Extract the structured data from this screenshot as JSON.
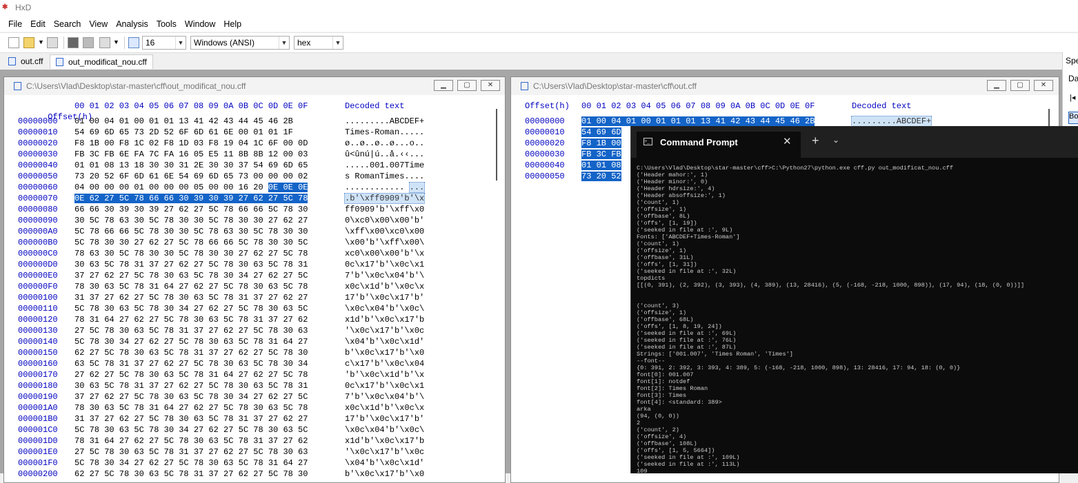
{
  "app": {
    "title": "HxD"
  },
  "menu": [
    "File",
    "Edit",
    "Search",
    "View",
    "Analysis",
    "Tools",
    "Window",
    "Help"
  ],
  "toolbar": {
    "bytes_per_row": "16",
    "charset": "Windows (ANSI)",
    "display": "hex"
  },
  "tabs": [
    {
      "label": "out.cff"
    },
    {
      "label": "out_modificat_nou.cff"
    }
  ],
  "right_panel": {
    "label_top": "Spe",
    "label_da": "Da",
    "label_bo": "Bo"
  },
  "left_window": {
    "path": "C:\\Users\\Vlad\\Desktop\\star-master\\cff\\out_modificat_nou.cff",
    "header_offset": "Offset(h)",
    "header_cols": "00 01 02 03 04 05 06 07 08 09 0A 0B 0C 0D 0E 0F",
    "header_text": "Decoded text",
    "rows": [
      {
        "o": "00000000",
        "h": "01 00 04 01 00 01 01 13 41 42 43 44 45 46 2B",
        "a": ".........ABCDEF+"
      },
      {
        "o": "00000010",
        "h": "54 69 6D 65 73 2D 52 6F 6D 61 6E 00 01 01 1F",
        "a": "Times-Roman....."
      },
      {
        "o": "00000020",
        "h": "F8 1B 00 F8 1C 02 F8 1D 03 F8 19 04 1C 6F 00 0D",
        "a": "ø..ø..ø..ø...o.."
      },
      {
        "o": "00000030",
        "h": "FB 3C FB 6E FA 7C FA 16 05 E5 11 8B 8B 12 00 03",
        "a": "û<ûnú|ú..å.‹‹..."
      },
      {
        "o": "00000040",
        "h": "01 01 08 13 18 30 30 31 2E 30 30 37 54 69 6D 65",
        "a": ".....001.007Time"
      },
      {
        "o": "00000050",
        "h": "73 20 52 6F 6D 61 6E 54 69 6D 65 73 00 00 00 02",
        "a": "s RomanTimes...."
      },
      {
        "o": "00000060",
        "h": "04 00 00 00 01 00 00 00 05 00 00 16 20 ",
        "hs": "0E 0E 0E",
        "a": "............ ",
        "as": "..."
      },
      {
        "o": "00000070",
        "hs": "0E 62 27 5C 78 66 66 30 39 30 39 27 62 27 5C 78",
        "as": ".b'\\xff0909'b'\\x"
      },
      {
        "o": "00000080",
        "h": "66 66 30 39 30 39 27 62 27 5C 78 66 66 5C 78 30",
        "a": "ff0909'b'\\xff\\x0"
      },
      {
        "o": "00000090",
        "h": "30 5C 78 63 30 5C 78 30 30 5C 78 30 30 27 62 27",
        "a": "0\\xc0\\x00\\x00'b'"
      },
      {
        "o": "000000A0",
        "h": "5C 78 66 66 5C 78 30 30 5C 78 63 30 5C 78 30 30",
        "a": "\\xff\\x00\\xc0\\x00"
      },
      {
        "o": "000000B0",
        "h": "5C 78 30 30 27 62 27 5C 78 66 66 5C 78 30 30 5C",
        "a": "\\x00'b'\\xff\\x00\\"
      },
      {
        "o": "000000C0",
        "h": "78 63 30 5C 78 30 30 5C 78 30 30 27 62 27 5C 78",
        "a": "xc0\\x00\\x00'b'\\x"
      },
      {
        "o": "000000D0",
        "h": "30 63 5C 78 31 37 27 62 27 5C 78 30 63 5C 78 31",
        "a": "0c\\x17'b'\\x0c\\x1"
      },
      {
        "o": "000000E0",
        "h": "37 27 62 27 5C 78 30 63 5C 78 30 34 27 62 27 5C",
        "a": "7'b'\\x0c\\x04'b'\\"
      },
      {
        "o": "000000F0",
        "h": "78 30 63 5C 78 31 64 27 62 27 5C 78 30 63 5C 78",
        "a": "x0c\\x1d'b'\\x0c\\x"
      },
      {
        "o": "00000100",
        "h": "31 37 27 62 27 5C 78 30 63 5C 78 31 37 27 62 27",
        "a": "17'b'\\x0c\\x17'b'"
      },
      {
        "o": "00000110",
        "h": "5C 78 30 63 5C 78 30 34 27 62 27 5C 78 30 63 5C",
        "a": "\\x0c\\x04'b'\\x0c\\"
      },
      {
        "o": "00000120",
        "h": "78 31 64 27 62 27 5C 78 30 63 5C 78 31 37 27 62",
        "a": "x1d'b'\\x0c\\x17'b"
      },
      {
        "o": "00000130",
        "h": "27 5C 78 30 63 5C 78 31 37 27 62 27 5C 78 30 63",
        "a": "'\\x0c\\x17'b'\\x0c"
      },
      {
        "o": "00000140",
        "h": "5C 78 30 34 27 62 27 5C 78 30 63 5C 78 31 64 27",
        "a": "\\x04'b'\\x0c\\x1d'"
      },
      {
        "o": "00000150",
        "h": "62 27 5C 78 30 63 5C 78 31 37 27 62 27 5C 78 30",
        "a": "b'\\x0c\\x17'b'\\x0"
      },
      {
        "o": "00000160",
        "h": "63 5C 78 31 37 27 62 27 5C 78 30 63 5C 78 30 34",
        "a": "c\\x17'b'\\x0c\\x04"
      },
      {
        "o": "00000170",
        "h": "27 62 27 5C 78 30 63 5C 78 31 64 27 62 27 5C 78",
        "a": "'b'\\x0c\\x1d'b'\\x"
      },
      {
        "o": "00000180",
        "h": "30 63 5C 78 31 37 27 62 27 5C 78 30 63 5C 78 31",
        "a": "0c\\x17'b'\\x0c\\x1"
      },
      {
        "o": "00000190",
        "h": "37 27 62 27 5C 78 30 63 5C 78 30 34 27 62 27 5C",
        "a": "7'b'\\x0c\\x04'b'\\"
      },
      {
        "o": "000001A0",
        "h": "78 30 63 5C 78 31 64 27 62 27 5C 78 30 63 5C 78",
        "a": "x0c\\x1d'b'\\x0c\\x"
      },
      {
        "o": "000001B0",
        "h": "31 37 27 62 27 5C 78 30 63 5C 78 31 37 27 62 27",
        "a": "17'b'\\x0c\\x17'b'"
      },
      {
        "o": "000001C0",
        "h": "5C 78 30 63 5C 78 30 34 27 62 27 5C 78 30 63 5C",
        "a": "\\x0c\\x04'b'\\x0c\\"
      },
      {
        "o": "000001D0",
        "h": "78 31 64 27 62 27 5C 78 30 63 5C 78 31 37 27 62",
        "a": "x1d'b'\\x0c\\x17'b"
      },
      {
        "o": "000001E0",
        "h": "27 5C 78 30 63 5C 78 31 37 27 62 27 5C 78 30 63",
        "a": "'\\x0c\\x17'b'\\x0c"
      },
      {
        "o": "000001F0",
        "h": "5C 78 30 34 27 62 27 5C 78 30 63 5C 78 31 64 27",
        "a": "\\x04'b'\\x0c\\x1d'"
      },
      {
        "o": "00000200",
        "h": "62 27 5C 78 30 63 5C 78 31 37 27 62 27 5C 78 30",
        "a": "b'\\x0c\\x17'b'\\x0"
      }
    ]
  },
  "right_window": {
    "path": "C:\\Users\\Vlad\\Desktop\\star-master\\cff\\out.cff",
    "header_offset": "Offset(h)",
    "header_cols": "00 01 02 03 04 05 06 07 08 09 0A 0B 0C 0D 0E 0F",
    "header_text": "Decoded text",
    "rows": [
      {
        "o": "00000000",
        "h": "01 00 04 01 00 01 01 01 13 41 42 43 44 45 46 2B",
        "a": ".........ABCDEF+"
      },
      {
        "o": "00000010",
        "h": "54 69 6D"
      },
      {
        "o": "00000020",
        "h": "F8 1B 00"
      },
      {
        "o": "00000030",
        "h": "FB 3C FB"
      },
      {
        "o": "00000040",
        "h": "01 01 08"
      },
      {
        "o": "00000050",
        "h": "73 20 52"
      }
    ]
  },
  "cmd": {
    "title": "Command Prompt",
    "lines": [
      "C:\\Users\\Vlad\\Desktop\\star-master\\cff>C:\\Python27\\python.exe cff.py out_modificat_nou.cff",
      "('Header mahor:', 1)",
      "('Header minor:', 0)",
      "('Header hdrsize:', 4)",
      "('Header absoffsize:', 1)",
      "('count', 1)",
      "('offsize', 1)",
      "('offbase', 8L)",
      "('offs', [1, 19])",
      "('seeked in file at :', 9L)",
      "Fonts: ['ABCDEF+Times-Roman']",
      "('count', 1)",
      "('offsize', 1)",
      "('offbase', 31L)",
      "('offs', [1, 31])",
      "('seeked in file at :', 32L)",
      "topdicts",
      "[[(0, 391), (2, 392), (3, 393), (4, 389), (13, 28416), (5, (-168, -218, 1000, 898)), (17, 94), (18, (0, 0))]]",
      "",
      "",
      "('count', 3)",
      "('offsize', 1)",
      "('offbase', 68L)",
      "('offs', [1, 8, 19, 24])",
      "('seeked in file at :', 69L)",
      "('seeked in file at :', 76L)",
      "('seeked in file at :', 87L)",
      "Strings: ['001.007', 'Times Roman', 'Times']",
      "--font--",
      "{0: 391, 2: 392, 3: 393, 4: 389, 5: (-168, -218, 1000, 898), 13: 28416, 17: 94, 18: (0, 0)}",
      "font[0]: 001.007",
      "font[1]: notdef",
      "font[2]: Times Roman",
      "font[3]: Times",
      "font[4]: <standard: 389>",
      "arka",
      "(94, (0, 0))",
      "2",
      "('count', 2)",
      "('offsize', 4)",
      "('offbase', 108L)",
      "('offs', [1, 5, 5664])",
      "('seeked in file at :', 109L)",
      "('seeked in file at :', 113L)",
      "109"
    ]
  }
}
